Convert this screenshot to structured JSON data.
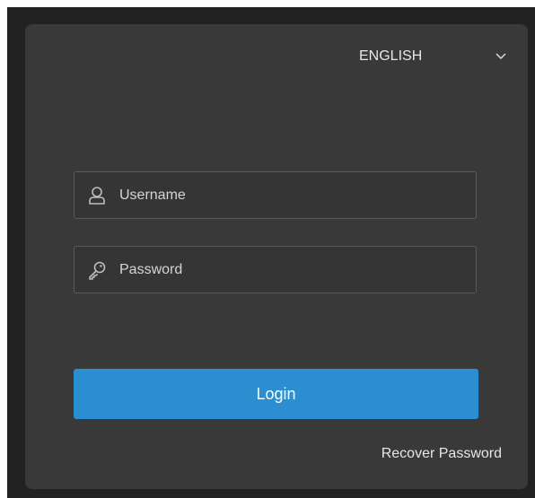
{
  "language_selector": {
    "selected": "ENGLISH",
    "icon": "chevron-down-icon"
  },
  "username_field": {
    "value": "",
    "placeholder": "Username",
    "icon": "user-icon"
  },
  "password_field": {
    "value": "",
    "placeholder": "Password",
    "icon": "key-icon"
  },
  "login_button": {
    "label": "Login"
  },
  "recover_link": {
    "label": "Recover Password"
  },
  "colors": {
    "accent": "#2a8ed0",
    "panel": "#393939",
    "backdrop": "#222222"
  }
}
